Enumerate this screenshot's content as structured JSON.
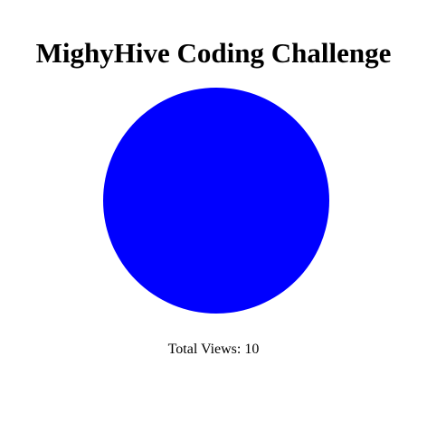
{
  "page": {
    "title": "MighyHive Coding Challenge"
  },
  "circle": {
    "fill_color": "#0000ff"
  },
  "stats": {
    "total_views_label": "Total Views:",
    "total_views_value": "10"
  }
}
